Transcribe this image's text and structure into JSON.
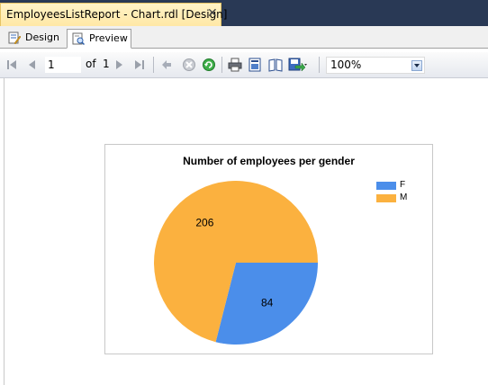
{
  "document_tab": {
    "title": "EmployeesListReport - Chart.rdl [Design]",
    "close_glyph": "✕"
  },
  "subtabs": {
    "design": "Design",
    "preview": "Preview"
  },
  "toolbar": {
    "current_page": "1",
    "of_label": "of",
    "total_pages": "1",
    "zoom": "100%",
    "icons": [
      "first-page-icon",
      "previous-page-icon",
      "next-page-icon",
      "last-page-icon",
      "back-icon",
      "stop-icon",
      "refresh-icon",
      "print-icon",
      "print-layout-icon",
      "page-setup-icon",
      "export-icon"
    ]
  },
  "colors": {
    "F": "#4b8eea",
    "M": "#fbb13f"
  },
  "chart_data": {
    "type": "pie",
    "title": "Number of employees per gender",
    "categories": [
      "F",
      "M"
    ],
    "values": [
      84,
      206
    ],
    "legend": "top-right"
  }
}
